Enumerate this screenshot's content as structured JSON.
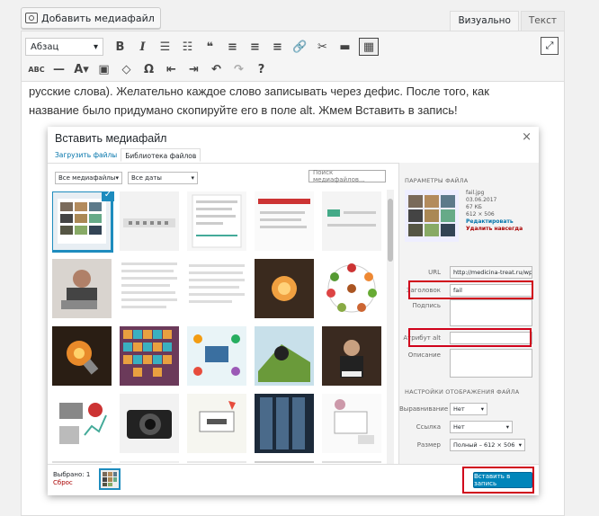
{
  "top": {
    "add_media_label": "Добавить медиафайл",
    "tab_visual": "Визуально",
    "tab_text": "Текст"
  },
  "toolbar": {
    "format_value": "Абзац",
    "row1_icons": [
      "bold-icon",
      "italic-icon",
      "bullet-list-icon",
      "numbered-list-icon",
      "blockquote-icon",
      "align-left-icon",
      "align-center-icon",
      "align-right-icon",
      "link-icon",
      "unlink-icon",
      "read-more-icon",
      "toolbar-toggle-icon"
    ],
    "row2_icons": [
      "strikethrough-icon",
      "horizontal-line-icon",
      "text-color-icon",
      "paste-text-icon",
      "clear-format-icon",
      "special-char-icon",
      "outdent-icon",
      "indent-icon",
      "undo-icon",
      "redo-icon",
      "help-icon"
    ]
  },
  "content": {
    "text": "русские слова). Желательно каждое слово записывать через дефис. После того, как название было придумано скопируйте его в поле alt. Жмем Вставить в запись!"
  },
  "modal": {
    "title": "Вставить медиафайл",
    "close": "×",
    "tab_upload": "Загрузить файлы",
    "tab_library": "Библиотека файлов",
    "filter_type": "Все медиафайлы",
    "filter_date": "Все даты",
    "search_placeholder": "Поиск медиафайлов...",
    "sidebar": {
      "heading": "ПАРАМЕТРЫ ФАЙЛА",
      "file_name": "fail.jpg",
      "file_date": "03.06.2017",
      "file_size": "67 КБ",
      "file_dims": "612 × 506",
      "edit_link": "Редактировать",
      "delete_link": "Удалить навсегда",
      "url_label": "URL",
      "url_value": "http://medicina-treat.ru/wp-",
      "title_label": "Заголовок",
      "title_value": "fail",
      "caption_label": "Подпись",
      "alt_label": "Атрибут alt",
      "desc_label": "Описание",
      "display_heading": "НАСТРОЙКИ ОТОБРАЖЕНИЯ ФАЙЛА",
      "align_label": "Выравнивание",
      "align_value": "Нет",
      "link_label": "Ссылка",
      "link_value": "Нет",
      "size_label": "Размер",
      "size_value": "Полный – 612 × 506"
    },
    "footer": {
      "selected": "Выбрано: 1",
      "reset": "Сброс",
      "insert_button": "Вставить в запись"
    }
  },
  "colors": {
    "accent": "#0085ba",
    "highlight": "#d0021b",
    "selection": "#1e8cbe"
  }
}
